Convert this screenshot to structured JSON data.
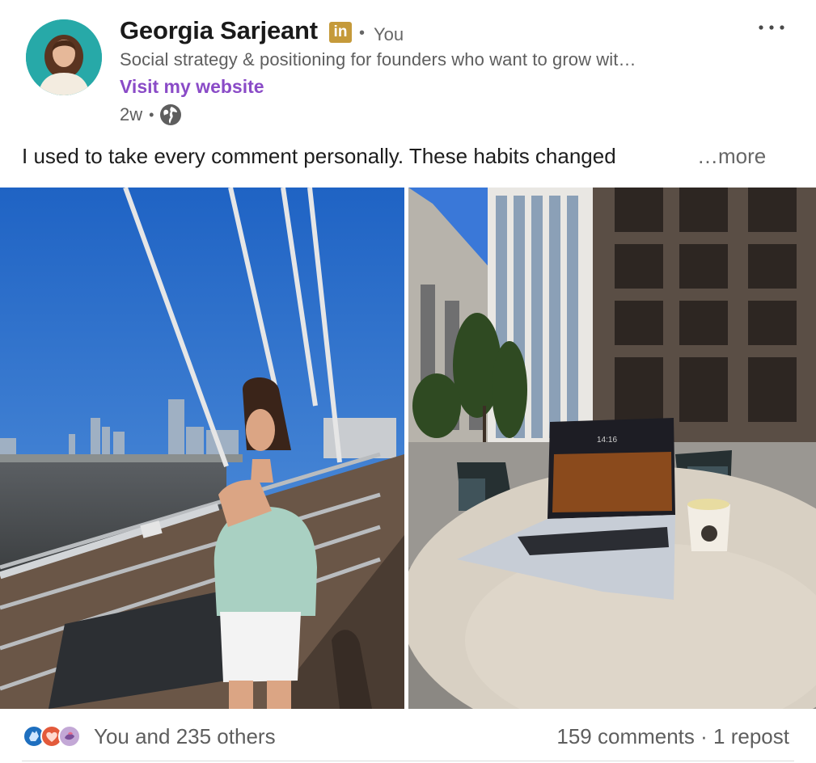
{
  "post": {
    "author": {
      "name": "Georgia Sarjeant",
      "badge_icon": "linkedin-premium-icon",
      "connection": "You",
      "headline": "Social strategy & positioning for founders who want to grow wit…",
      "website_link": "Visit my website"
    },
    "time_ago": "2w",
    "visibility_icon": "globe-icon",
    "text": "I used to take every comment personally. These habits changed",
    "see_more": "…more",
    "images": [
      {
        "icon": "photo-woman-on-bridge"
      },
      {
        "icon": "photo-laptop-on-table"
      }
    ],
    "laptop_screen_time": "14:16",
    "social": {
      "reaction_icons": [
        "clap-icon",
        "heart-icon",
        "support-icon"
      ],
      "reactions_text": "You and 235 others",
      "comments": "159 comments",
      "separator": "·",
      "reposts": "1 repost"
    }
  },
  "colors": {
    "link_purple": "#8a4bc7",
    "linkedin_badge": "#c59a3a",
    "muted_text": "#5e5e5e"
  }
}
